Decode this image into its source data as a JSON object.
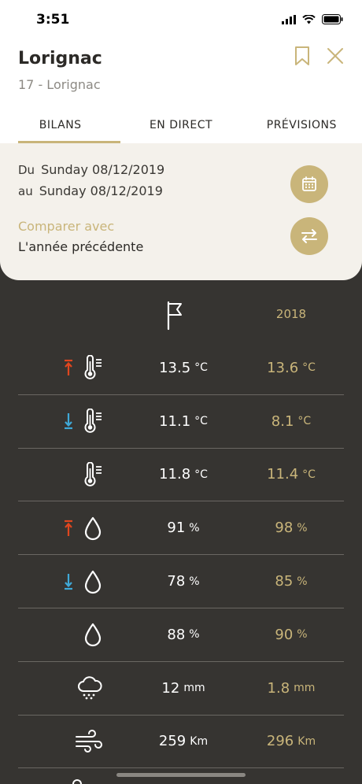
{
  "status": {
    "time": "3:51"
  },
  "header": {
    "title": "Lorignac",
    "subtitle": "17 - Lorignac"
  },
  "tabs": [
    {
      "label": "BILANS",
      "active": true
    },
    {
      "label": "EN DIRECT",
      "active": false
    },
    {
      "label": "PRÉVISIONS",
      "active": false
    }
  ],
  "period": {
    "from_label": "Du",
    "from_value": "Sunday 08/12/2019",
    "to_label": "au",
    "to_value": "Sunday 08/12/2019"
  },
  "compare": {
    "label": "Comparer avec",
    "value": "L'année précédente"
  },
  "table": {
    "compare_year": "2018",
    "rows": [
      {
        "indicator": "max",
        "icon": "thermometer-icon",
        "value": "13.5",
        "unit": "°C",
        "compare": "13.6",
        "compare_unit": "°C"
      },
      {
        "indicator": "min",
        "icon": "thermometer-icon",
        "value": "11.1",
        "unit": "°C",
        "compare": "8.1",
        "compare_unit": "°C"
      },
      {
        "indicator": "avg",
        "icon": "thermometer-icon",
        "value": "11.8",
        "unit": "°C",
        "compare": "11.4",
        "compare_unit": "°C"
      },
      {
        "indicator": "max",
        "icon": "humidity-drop-icon",
        "value": "91",
        "unit": "%",
        "compare": "98",
        "compare_unit": "%"
      },
      {
        "indicator": "min",
        "icon": "humidity-drop-icon",
        "value": "78",
        "unit": "%",
        "compare": "85",
        "compare_unit": "%"
      },
      {
        "indicator": "avg",
        "icon": "humidity-drop-icon",
        "value": "88",
        "unit": "%",
        "compare": "90",
        "compare_unit": "%"
      },
      {
        "indicator": "none",
        "icon": "rain-cloud-icon",
        "value": "12",
        "unit": "mm",
        "compare": "1.8",
        "compare_unit": "mm"
      },
      {
        "indicator": "none",
        "icon": "wind-icon",
        "value": "259",
        "unit": "Km",
        "compare": "296",
        "compare_unit": "Km"
      }
    ]
  },
  "colors": {
    "accent": "#c9b57a",
    "dark_bg": "#363431",
    "max_arrow": "#e0461f",
    "min_arrow": "#3fa9d8"
  }
}
